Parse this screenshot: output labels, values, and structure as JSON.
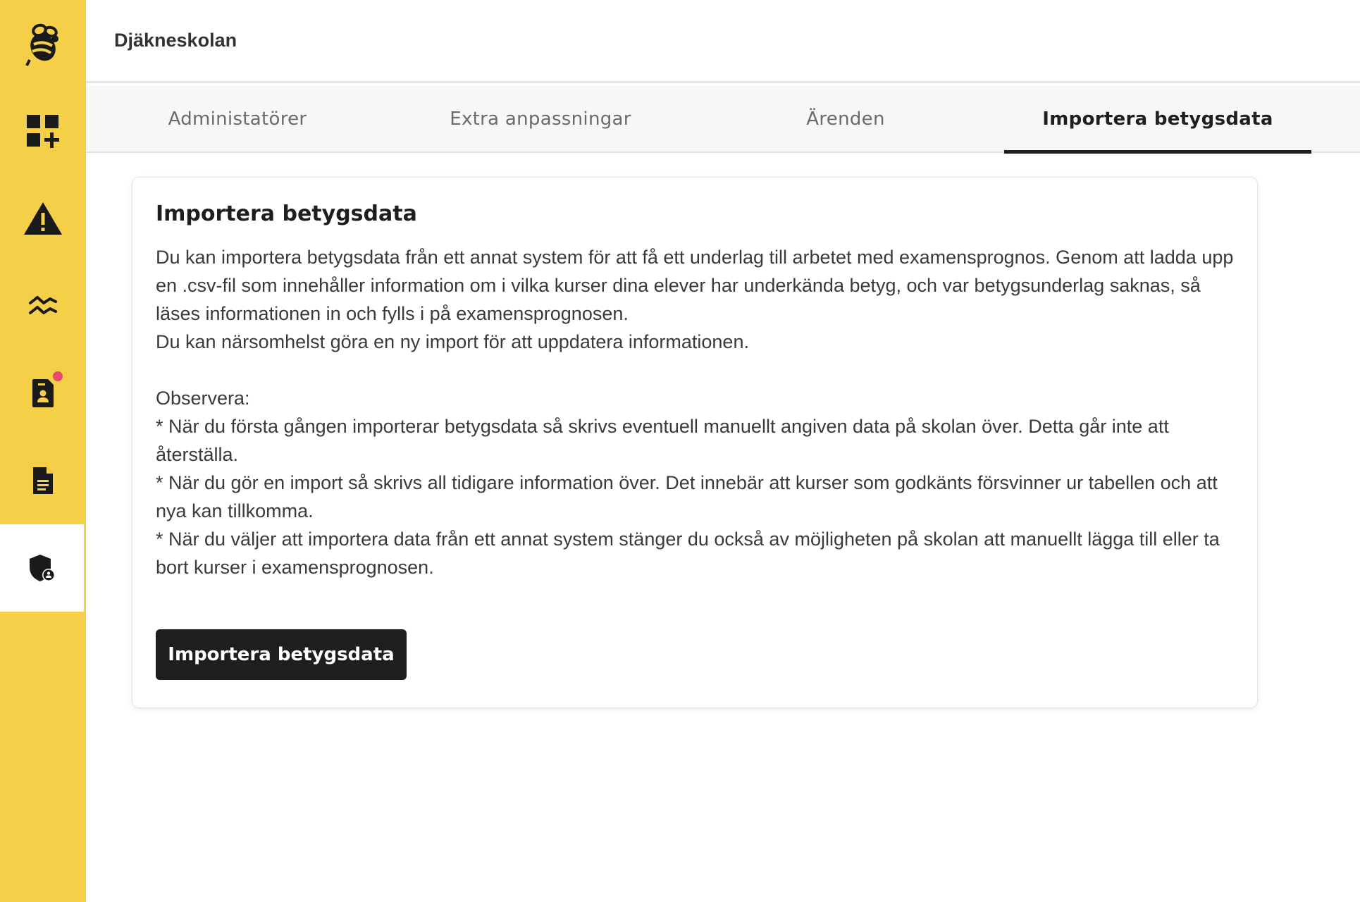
{
  "header": {
    "school_name": "Djäkneskolan"
  },
  "sidebar": {
    "items": [
      {
        "icon": "bee-logo-icon"
      },
      {
        "icon": "dashboard-add-icon"
      },
      {
        "icon": "warning-icon"
      },
      {
        "icon": "trend-lines-icon"
      },
      {
        "icon": "student-document-icon",
        "has_notification": true
      },
      {
        "icon": "document-icon"
      },
      {
        "icon": "shield-admin-icon",
        "active": true
      }
    ],
    "notification_color": "#e94a6b"
  },
  "tabs": [
    {
      "label": "Administatörer",
      "active": false
    },
    {
      "label": "Extra anpassningar",
      "active": false
    },
    {
      "label": "Ärenden",
      "active": false
    },
    {
      "label": "Importera betygsdata",
      "active": true
    }
  ],
  "card": {
    "title": "Importera betygsdata",
    "intro": "Du kan importera betygsdata från ett annat system för att få ett underlag till arbetet med examensprognos. Genom att ladda upp en .csv-fil som innehåller information om i vilka kurser dina elever har underkända betyg, och var betygsunderlag saknas, så läses informationen in och fylls i på examensprognosen.",
    "intro2": "Du kan närsomhelst göra en ny import för att uppdatera informationen.",
    "observe_label": "Observera:",
    "notes": [
      "* När du första gången importerar betygsdata så skrivs eventuell manuellt angiven data på skolan över. Detta går inte att återställa.",
      "* När du gör en import så skrivs all tidigare information över. Det innebär att kurser som godkänts försvinner ur tabellen och att nya kan tillkomma.",
      "* När du väljer att importera data från ett annat system stänger du också av möjligheten på skolan att manuellt lägga till eller ta bort kurser i examensprognosen."
    ],
    "button_label": "Importera betygsdata"
  },
  "colors": {
    "sidebar": "#f4cf47",
    "primary_button": "#1e1e1e",
    "tab_bar": "#f7f7f7"
  }
}
